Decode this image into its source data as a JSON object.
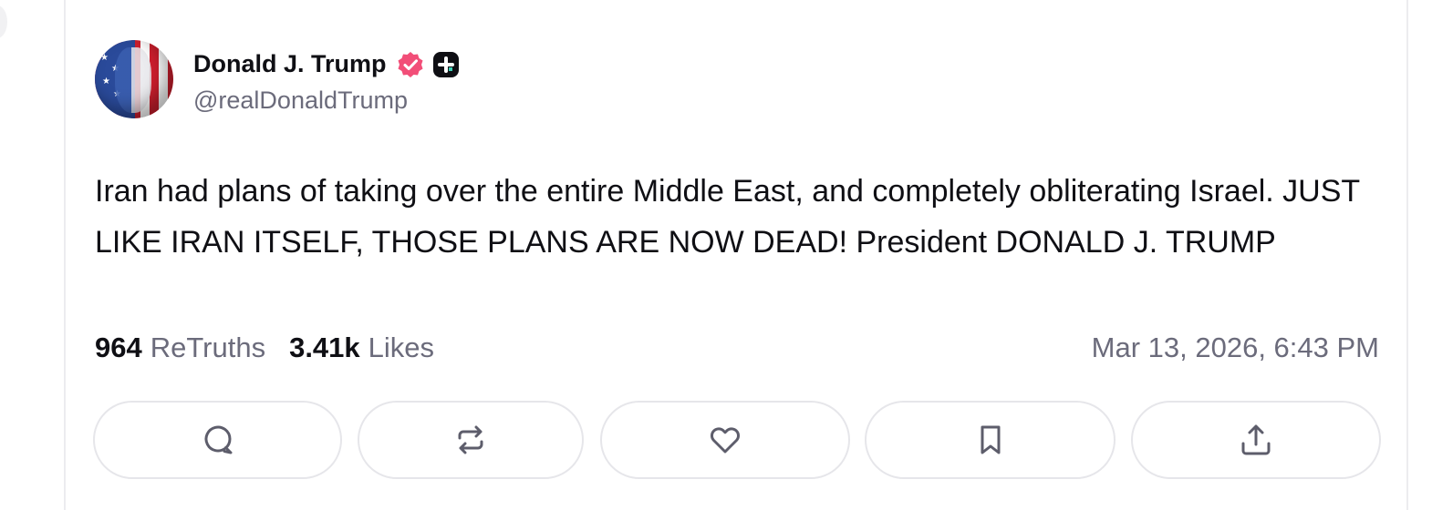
{
  "post": {
    "author_name": "Donald J. Trump",
    "handle": "@realDonaldTrump",
    "text": "Iran had plans of taking over the entire Middle East, and completely obliterating Israel. JUST LIKE IRAN ITSELF, THOSE PLANS ARE NOW DEAD! President DONALD J. TRUMP",
    "retruths_count": "964",
    "retruths_label": "ReTruths",
    "likes_count": "3.41k",
    "likes_label": "Likes",
    "timestamp": "Mar 13, 2026, 6:43 PM"
  },
  "badges": {
    "verified_icon": "verified-badge-icon",
    "verified_color": "#f24e78",
    "plus_icon": "plus-badge-icon"
  },
  "actions": [
    {
      "name": "reply",
      "icon": "comment-icon"
    },
    {
      "name": "retruth",
      "icon": "repost-icon"
    },
    {
      "name": "like",
      "icon": "heart-icon"
    },
    {
      "name": "bookmark",
      "icon": "bookmark-icon"
    },
    {
      "name": "share",
      "icon": "share-icon"
    }
  ],
  "colors": {
    "text_primary": "#0f0f14",
    "text_secondary": "#6b6b7b",
    "border": "#e6e6ea",
    "icon": "#5d5d6b"
  }
}
